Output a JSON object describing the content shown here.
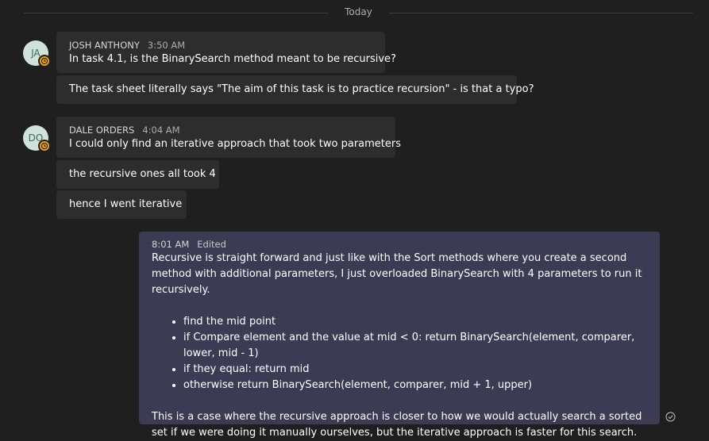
{
  "divider": {
    "label": "Today"
  },
  "messages": [
    {
      "avatar_initials": "JA",
      "sender": "JOSH ANTHONY",
      "time": "3:50 AM",
      "lines": [
        "In task 4.1, is the BinarySearch method meant to be recursive?",
        "The task sheet literally says \"The aim of this task is to practice recursion\" - is that a typo?"
      ]
    },
    {
      "avatar_initials": "DO",
      "sender": "DALE ORDERS",
      "time": "4:04 AM",
      "lines": [
        "I could only find an iterative approach that took two parameters",
        "the recursive ones all took 4",
        "hence I went iterative"
      ]
    }
  ],
  "my_message": {
    "time": "8:01 AM",
    "edited_label": "Edited",
    "intro": "Recursive is straight forward and just like with the Sort methods where you create a second method with additional parameters, I just overloaded BinarySearch with 4 parameters to run it recursively.",
    "bullets": [
      "find the mid point",
      "if Compare element and the value at mid < 0: return BinarySearch(element, comparer, lower, mid - 1)",
      "if they equal: return mid",
      "otherwise return BinarySearch(element, comparer, mid + 1, upper)"
    ],
    "outro": "This is a case where the recursive approach is closer to how we would actually search a sorted set if we were doing it manually ourselves, but the iterative approach is faster for this search."
  },
  "icons": {
    "status": "away-clock-icon",
    "read_receipt": "seen-check-icon"
  },
  "colors": {
    "background": "#1f1f1f",
    "bubble": "#2d2d2d",
    "my_bubble": "#3b3b53",
    "away_status": "#f0a30a",
    "avatar_bg": "#cfe3db"
  }
}
